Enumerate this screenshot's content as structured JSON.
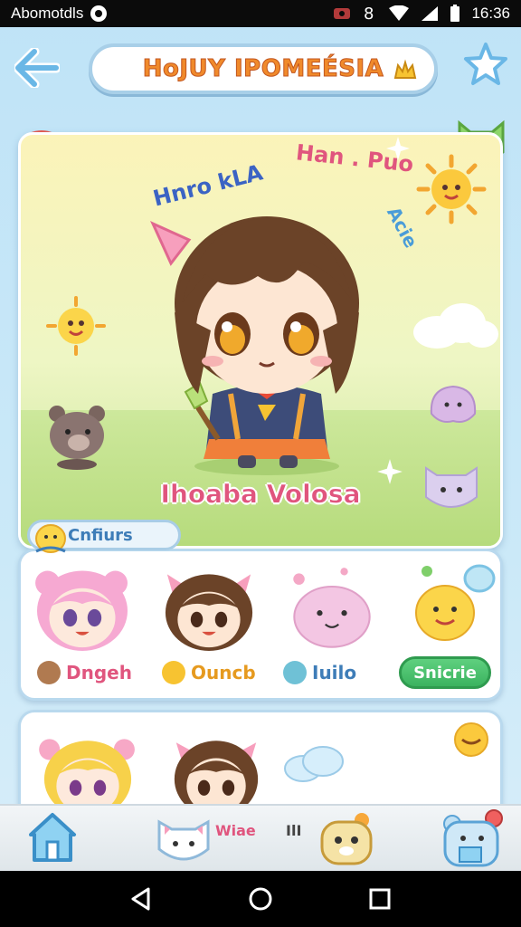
{
  "status_bar": {
    "app_label": "Abomotdls",
    "time": "16:36"
  },
  "header": {
    "title": "HoJUY IPOMEÉSIA"
  },
  "hero": {
    "arc_text_left": "Hnro kLA",
    "arc_text_right": "Han . Puo",
    "arc_text_side": "Acie",
    "character_name": "Ihoaba Volosa"
  },
  "section": {
    "label": "Cnfiurs"
  },
  "row1": {
    "chip_1": "Dngeh",
    "chip_2": "Ouncb",
    "chip_3": "Iuilo",
    "chip_4": "Snicrie"
  },
  "bottom_nav": {
    "text_1": "Wiae",
    "text_2": "IlI"
  },
  "colors": {
    "accent_pink": "#e0557e",
    "accent_blue": "#3e7db8",
    "accent_orange": "#f08a2b",
    "accent_green": "#3bb35f"
  }
}
